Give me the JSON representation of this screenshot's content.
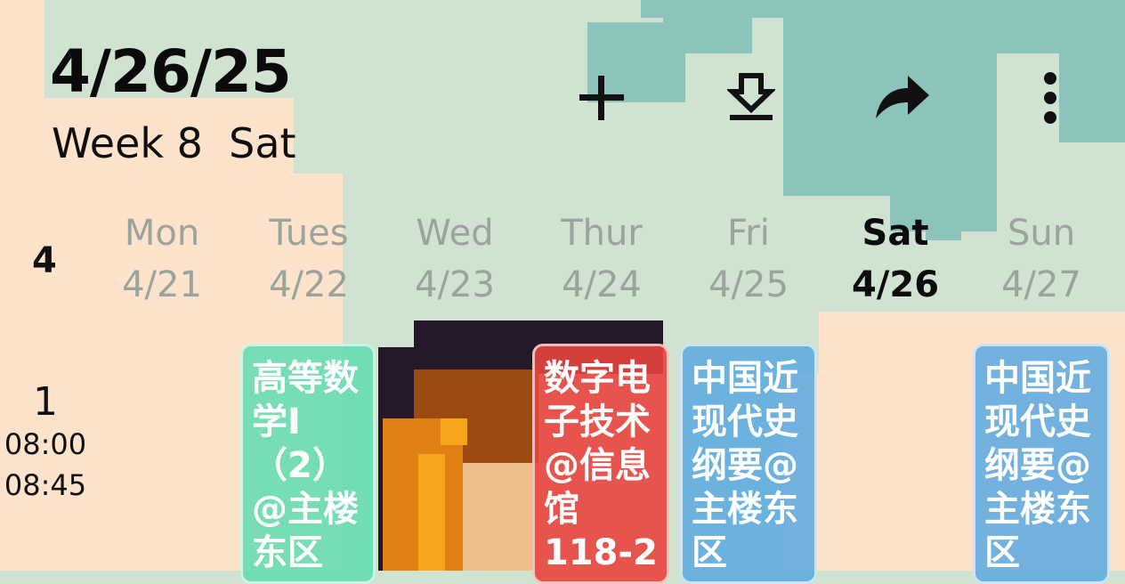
{
  "header": {
    "date": "4/26/25",
    "week": "Week 8",
    "weekday": "Sat"
  },
  "toolbar": {
    "add_icon": "plus-icon",
    "download_icon": "download-icon",
    "share_icon": "share-icon",
    "more_icon": "more-vertical-icon"
  },
  "calendar": {
    "month": "4",
    "days": [
      {
        "name": "Mon",
        "date": "4/21"
      },
      {
        "name": "Tues",
        "date": "4/22"
      },
      {
        "name": "Wed",
        "date": "4/23"
      },
      {
        "name": "Thur",
        "date": "4/24"
      },
      {
        "name": "Fri",
        "date": "4/25"
      },
      {
        "name": "Sat",
        "date": "4/26"
      },
      {
        "name": "Sun",
        "date": "4/27"
      }
    ],
    "periods": [
      {
        "number": "1",
        "start": "08:00",
        "end": "08:45"
      }
    ]
  },
  "courses": [
    {
      "text": "高等数学I（2）@主楼东区",
      "color": "#63dcb0"
    },
    {
      "text": "数字电子技术@信息馆118-2",
      "color": "#e8443e"
    },
    {
      "text": "中国近现代史纲要@主楼东区",
      "color": "#5aa9e0"
    },
    {
      "text": "中国近现代史纲要@主楼东区",
      "color": "#5aa9e0"
    }
  ],
  "colors": {
    "bg_mint": "#cfe3d0",
    "bg_teal": "#8cc4bb",
    "bg_peach": "#fde3cc",
    "active_text": "#0b0b0b",
    "inactive_text": "#9aa39c"
  }
}
